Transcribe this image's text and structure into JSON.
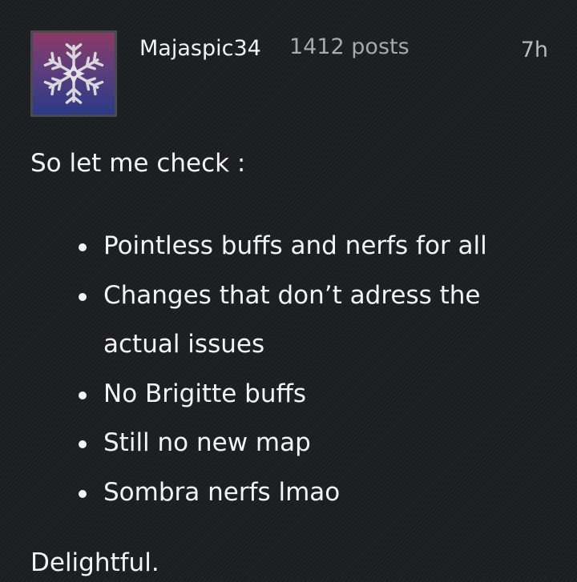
{
  "post": {
    "author": {
      "username": "Majaspic34",
      "post_count": "1412 posts",
      "avatar_icon": "snowflake-icon"
    },
    "timestamp": "7h",
    "body": {
      "intro": "So let me check :",
      "bullets": [
        "Pointless buffs and nerfs for all",
        "Changes that don’t adress the actual issues",
        "No Brigitte buffs",
        "Still no new map",
        "Sombra nerfs lmao"
      ],
      "outro": "Delightful."
    }
  },
  "colors": {
    "background": "#1c1d20",
    "text": "#f4f4f4",
    "muted_text": "#a8a8ad",
    "avatar_gradient_top": "#8a3a66",
    "avatar_gradient_bottom": "#2a3a86"
  }
}
